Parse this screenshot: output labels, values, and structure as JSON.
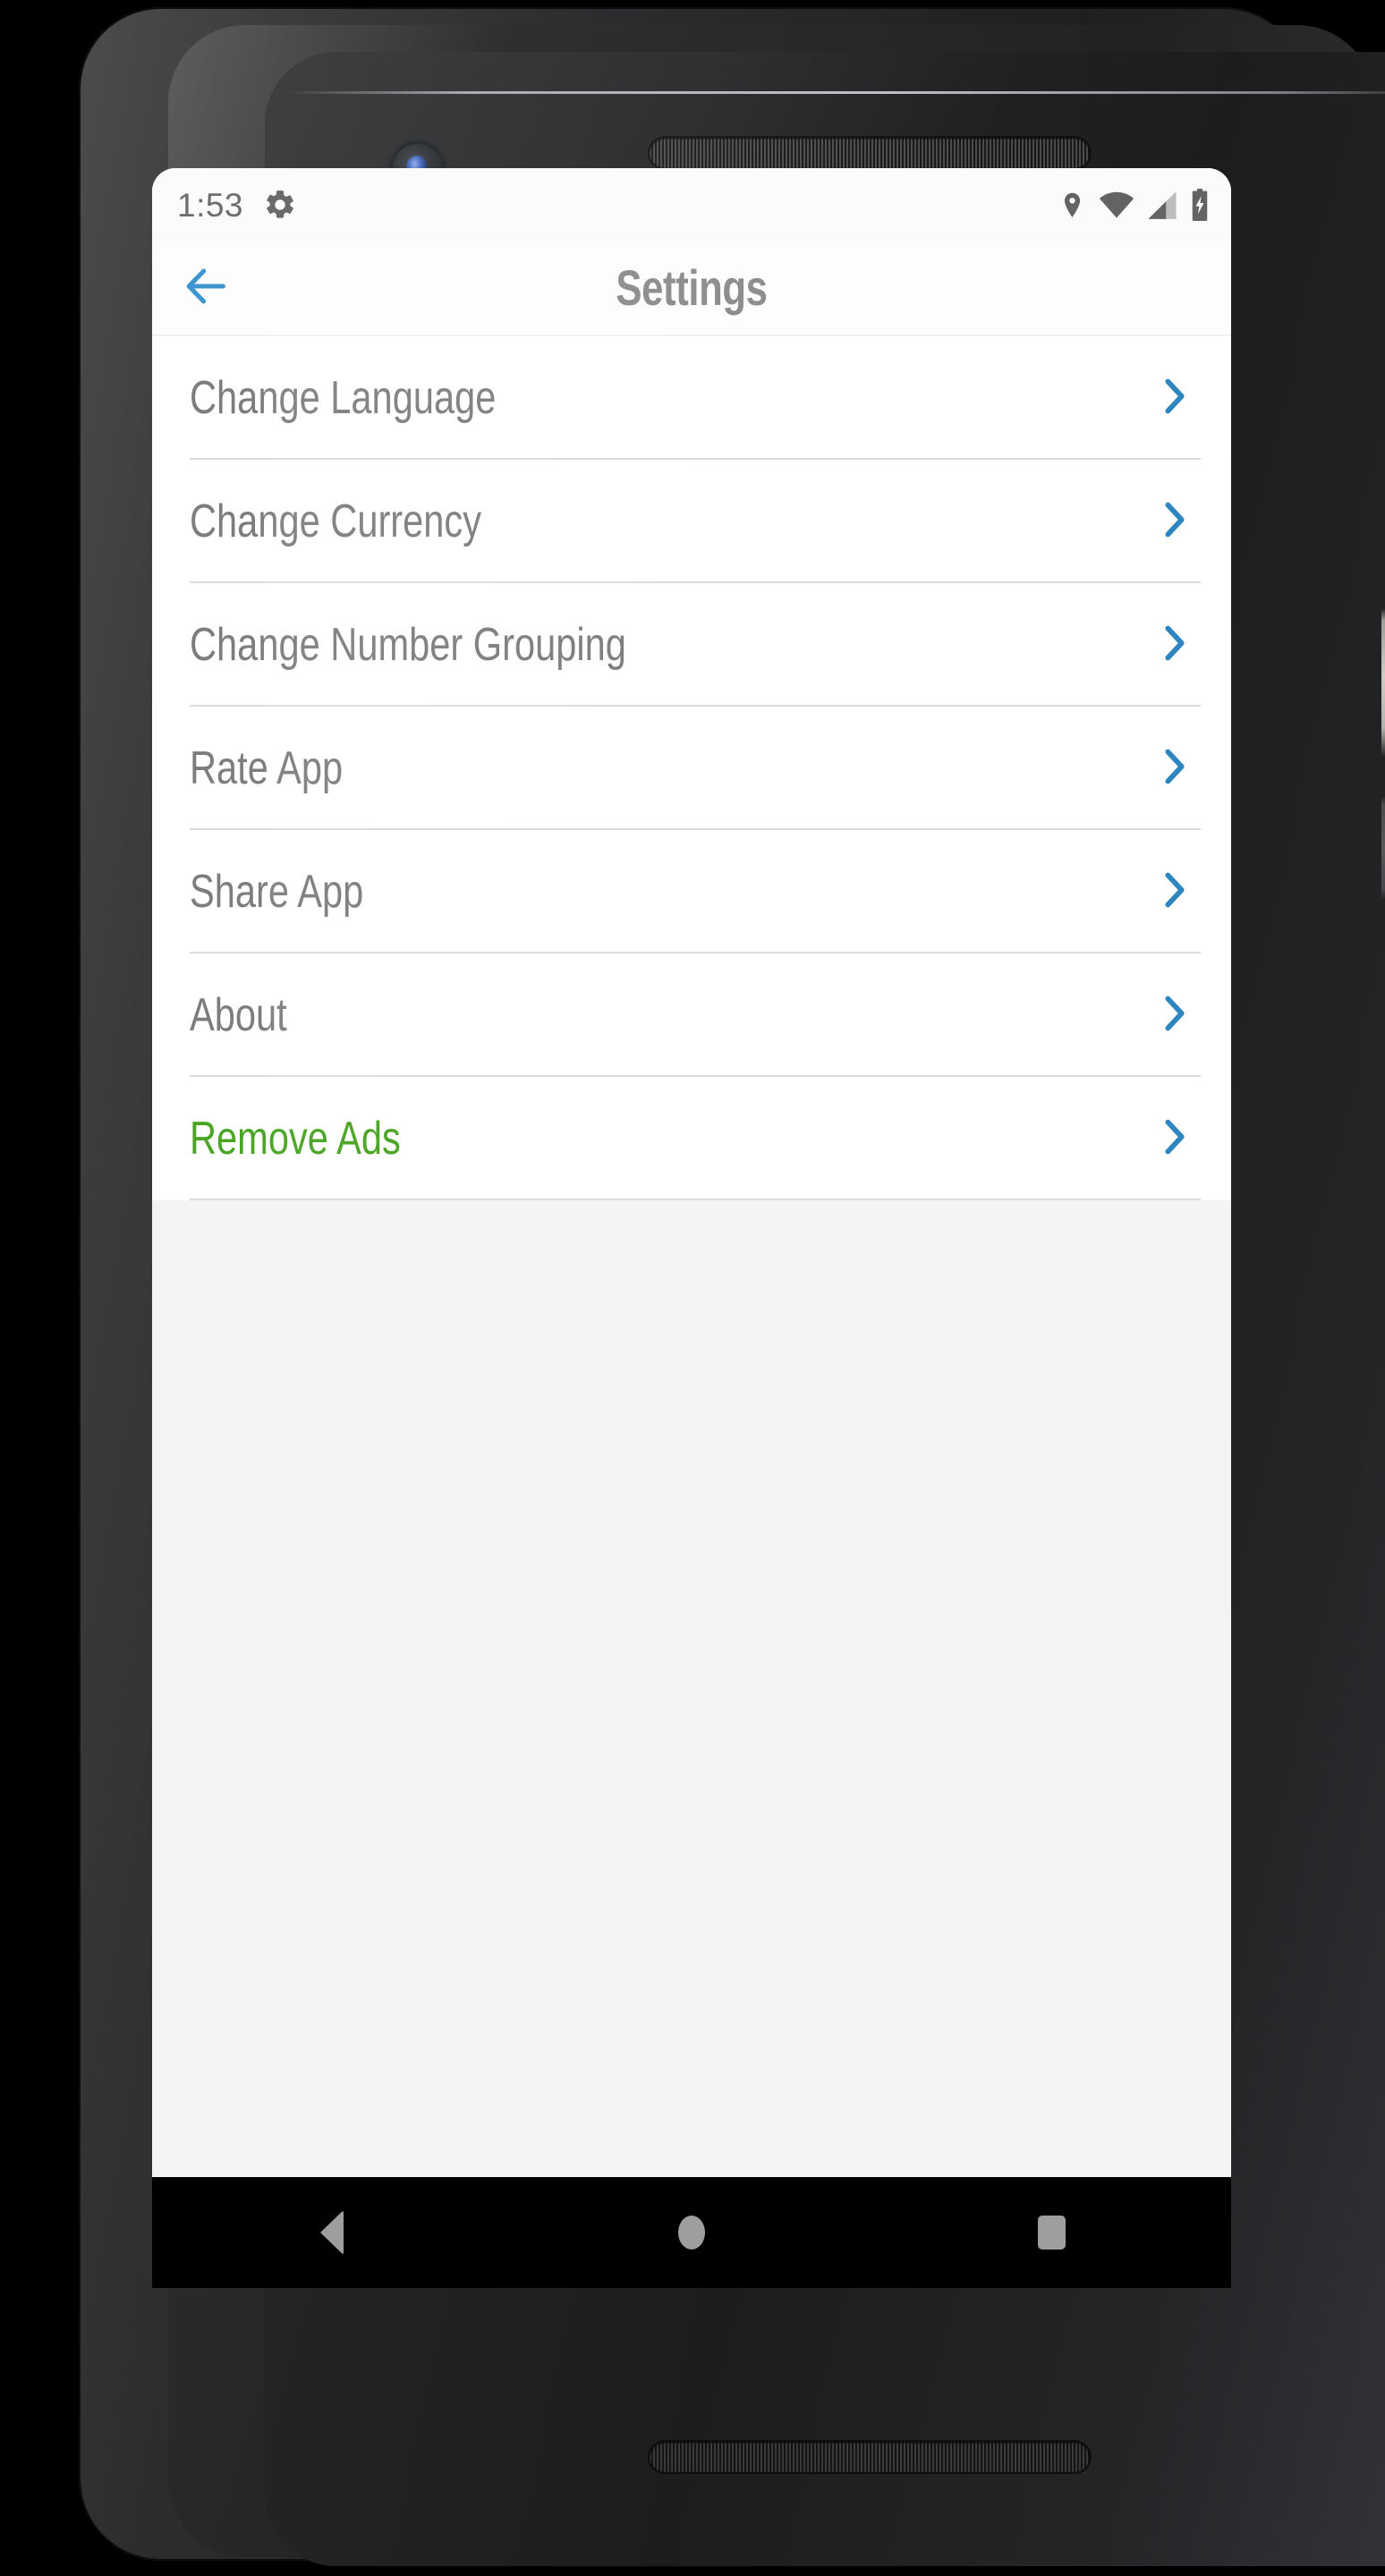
{
  "device": {
    "frame": "android-phone",
    "body_color": "#2b2d2f"
  },
  "status_bar": {
    "time": "1:53",
    "left_icons": [
      "gear-icon"
    ],
    "right_icons": [
      "location-icon",
      "wifi-icon",
      "cellular-signal-icon",
      "battery-charging-icon"
    ],
    "text_color": "#6d6d6d",
    "background": "#fbfbfb"
  },
  "app_bar": {
    "back_label": "back-arrow-icon",
    "title": "Settings",
    "title_color": "#8b8b8b",
    "accent_color": "#3f95d0",
    "background": "#fdfdfd"
  },
  "settings_list": {
    "divider_color": "#dcdcdc",
    "chevron_color": "#2e86c1",
    "default_text_color": "#7d7d7d",
    "highlight_text_color": "#4aa524",
    "background": "#ffffff",
    "empty_area_color": "#f4f4f4",
    "items": [
      {
        "label": "Change Language",
        "highlight": false,
        "chevron": "chevron-right-icon"
      },
      {
        "label": "Change Currency",
        "highlight": false,
        "chevron": "chevron-right-icon"
      },
      {
        "label": "Change Number Grouping",
        "highlight": false,
        "chevron": "chevron-right-icon"
      },
      {
        "label": "Rate App",
        "highlight": false,
        "chevron": "chevron-right-icon"
      },
      {
        "label": "Share App",
        "highlight": false,
        "chevron": "chevron-right-icon"
      },
      {
        "label": "About",
        "highlight": false,
        "chevron": "chevron-right-icon"
      },
      {
        "label": "Remove Ads",
        "highlight": true,
        "chevron": "chevron-right-icon"
      }
    ]
  },
  "nav_bar": {
    "background": "#000000",
    "icon_color": "#9e9e9e",
    "buttons": [
      {
        "name": "back",
        "icon": "triangle-back-icon"
      },
      {
        "name": "home",
        "icon": "circle-home-icon"
      },
      {
        "name": "recents",
        "icon": "square-recents-icon"
      }
    ]
  }
}
